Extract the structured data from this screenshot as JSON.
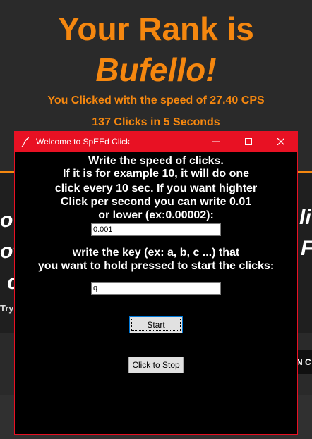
{
  "background_page": {
    "title_line1": "Your Rank is",
    "title_line2": "Bufello!",
    "speed_text": "You Clicked with the speed of 27.40 CPS",
    "clicks_text": "137 Clicks in 5 Seconds",
    "partial_left_letters": [
      "o",
      "ot",
      "c"
    ],
    "partial_right_letters": [
      "li",
      "F"
    ],
    "partial_try": "Try",
    "partial_button": "N C",
    "accent_color": "#f5870f"
  },
  "dialog": {
    "title": "Welcome to SpEEd Click",
    "titlebar_color": "#e81123",
    "app_icon": "feather-icon",
    "instruction_lines": [
      "Write the speed of clicks.",
      "If it is for example 10, it will do one",
      "click every 10 sec. If you want highter",
      "Click per second you can write 0.01",
      "or lower (ex:0.00002):"
    ],
    "speed_value": "0.001",
    "key_instruction_lines": [
      "write the key (ex: a, b, c ...) that",
      "you want to hold pressed to start the clicks:"
    ],
    "key_value": "q",
    "start_label": "Start",
    "stop_label": "Click to Stop"
  }
}
